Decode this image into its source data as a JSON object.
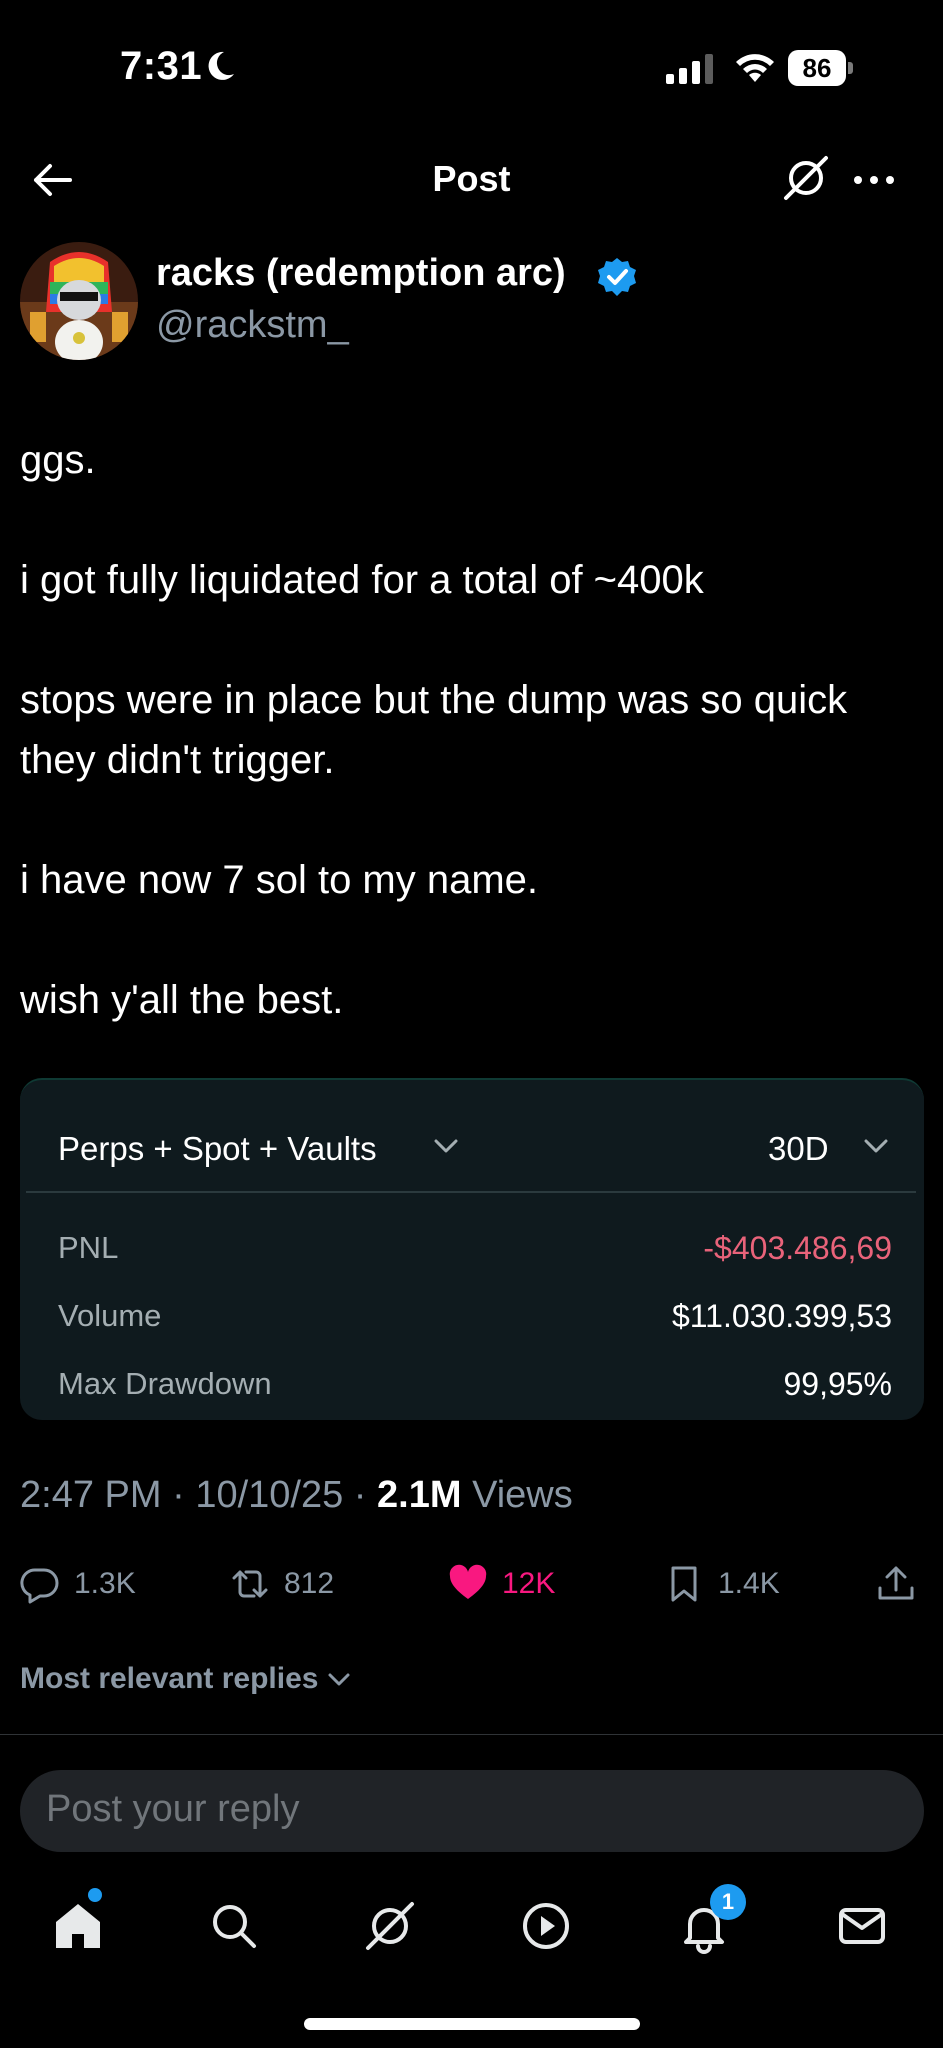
{
  "status_bar": {
    "time": "7:31",
    "battery": "86"
  },
  "header": {
    "title": "Post"
  },
  "author": {
    "display_name": "racks (redemption arc)",
    "handle": "@rackstm_"
  },
  "tweet": {
    "paragraphs": [
      "ggs.",
      "i got fully liquidated for a total of ~400k",
      "stops were in place but the dump was so quick they didn't trigger.",
      "i have now 7 sol to my name.",
      "wish y'all the best."
    ]
  },
  "card": {
    "filter_label": "Perps + Spot + Vaults",
    "period": "30D",
    "rows": [
      {
        "label": "PNL",
        "value": "-$403.486,69"
      },
      {
        "label": "Volume",
        "value": "$11.030.399,53"
      },
      {
        "label": "Max Drawdown",
        "value": "99,95%"
      }
    ],
    "negative_color": "#e9637a"
  },
  "meta": {
    "time": "2:47 PM",
    "date": "10/10/25",
    "views_count": "2.1M",
    "views_label": "Views"
  },
  "actions": {
    "replies": "1.3K",
    "reposts": "812",
    "likes": "12K",
    "bookmarks": "1.4K"
  },
  "colors": {
    "like": "#f91880",
    "accent": "#1d9bf0",
    "verified": "#1d9bf0"
  },
  "replies_sort": "Most relevant replies",
  "reply_box": {
    "placeholder": "Post your reply"
  },
  "tab_bar": {
    "notifications_badge": "1"
  }
}
